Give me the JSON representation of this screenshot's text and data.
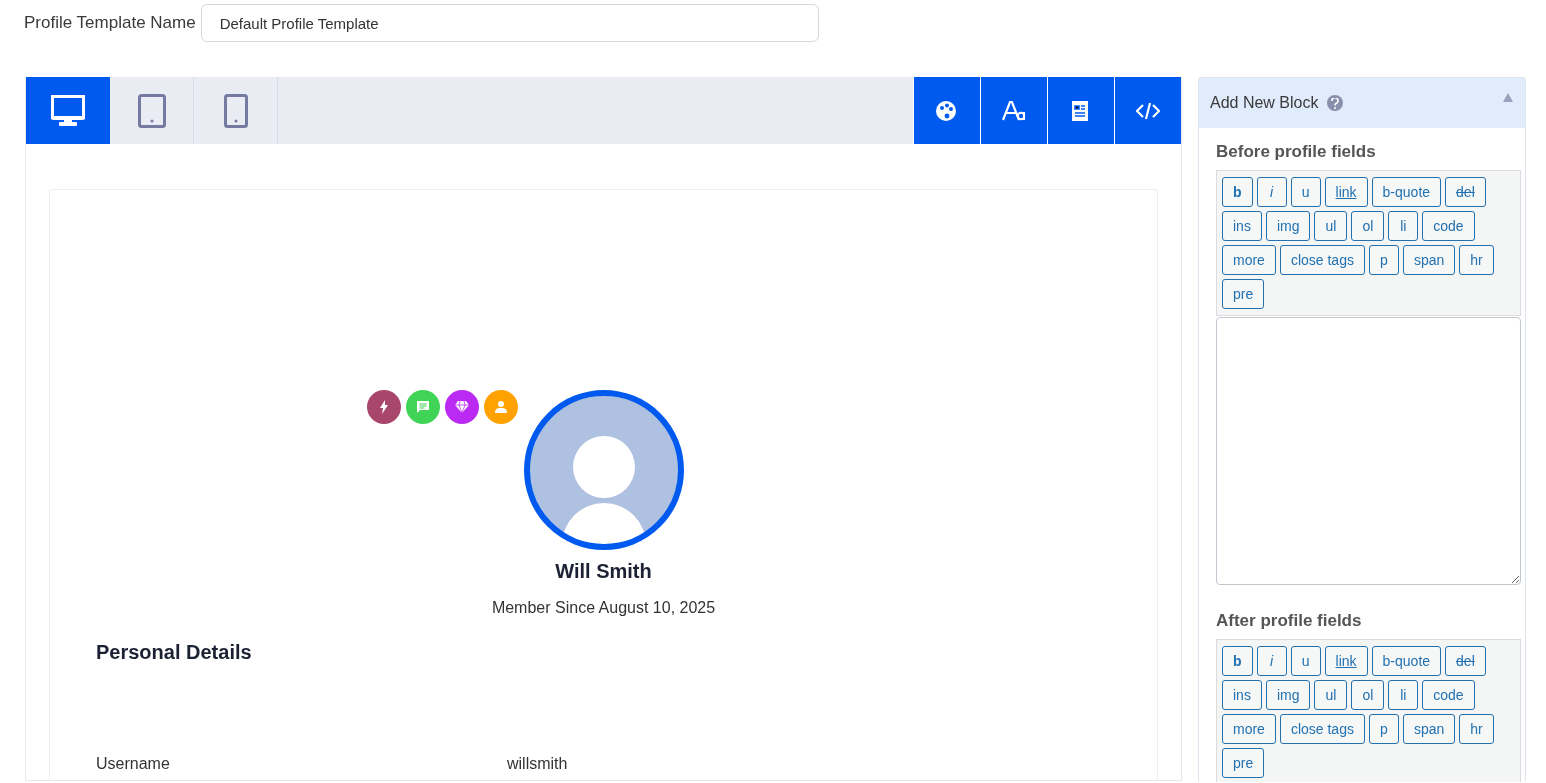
{
  "template_name": {
    "label": "Profile Template Name",
    "value": "Default Profile Template"
  },
  "device_tabs": [
    {
      "kind": "desktop",
      "selected": true
    },
    {
      "kind": "tablet",
      "selected": false
    },
    {
      "kind": "mobile",
      "selected": false
    }
  ],
  "profile": {
    "badges": [
      {
        "kind": "bolt",
        "color": "#a8466c"
      },
      {
        "kind": "chat",
        "color": "#3fd455"
      },
      {
        "kind": "gem",
        "color": "#bb2af2"
      },
      {
        "kind": "user",
        "color": "#ffa200"
      }
    ],
    "name": "Will Smith",
    "member_since": "Member Since August 10, 2025",
    "section_title": "Personal Details",
    "fields": [
      {
        "label": "Username",
        "value": "willsmith"
      }
    ]
  },
  "sidebar": {
    "title": "Add New Block",
    "expanded": true,
    "editors": [
      {
        "title": "Before profile fields",
        "tags": [
          {
            "label": "b",
            "kind": "bold"
          },
          {
            "label": "i",
            "kind": "italic"
          },
          {
            "label": "u",
            "kind": "plain"
          },
          {
            "label": "link",
            "kind": "underline"
          },
          {
            "label": "b-quote",
            "kind": "plain"
          },
          {
            "label": "del",
            "kind": "strike"
          },
          {
            "label": "ins",
            "kind": "plain"
          },
          {
            "label": "img",
            "kind": "plain"
          },
          {
            "label": "ul",
            "kind": "plain"
          },
          {
            "label": "ol",
            "kind": "plain"
          },
          {
            "label": "li",
            "kind": "plain"
          },
          {
            "label": "code",
            "kind": "plain"
          },
          {
            "label": "more",
            "kind": "plain"
          },
          {
            "label": "close tags",
            "kind": "plain"
          },
          {
            "label": "p",
            "kind": "plain"
          },
          {
            "label": "span",
            "kind": "plain"
          },
          {
            "label": "hr",
            "kind": "plain"
          },
          {
            "label": "pre",
            "kind": "plain"
          }
        ]
      },
      {
        "title": "After profile fields",
        "tags": [
          {
            "label": "b",
            "kind": "bold"
          },
          {
            "label": "i",
            "kind": "italic"
          },
          {
            "label": "u",
            "kind": "plain"
          },
          {
            "label": "link",
            "kind": "underline"
          },
          {
            "label": "b-quote",
            "kind": "plain"
          },
          {
            "label": "del",
            "kind": "strike"
          },
          {
            "label": "ins",
            "kind": "plain"
          },
          {
            "label": "img",
            "kind": "plain"
          },
          {
            "label": "ul",
            "kind": "plain"
          },
          {
            "label": "ol",
            "kind": "plain"
          },
          {
            "label": "li",
            "kind": "plain"
          },
          {
            "label": "code",
            "kind": "plain"
          },
          {
            "label": "more",
            "kind": "plain"
          },
          {
            "label": "close tags",
            "kind": "plain"
          },
          {
            "label": "p",
            "kind": "plain"
          },
          {
            "label": "span",
            "kind": "plain"
          },
          {
            "label": "hr",
            "kind": "plain"
          },
          {
            "label": "pre",
            "kind": "plain"
          }
        ]
      }
    ]
  }
}
